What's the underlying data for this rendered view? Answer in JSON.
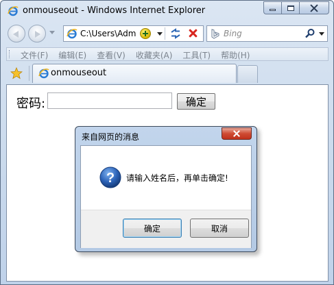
{
  "window": {
    "title": "onmouseout - Windows Internet Explorer"
  },
  "address": {
    "url": "C:\\Users\\Adm"
  },
  "search": {
    "placeholder": "Bing"
  },
  "menu": {
    "items": [
      "文件(F)",
      "编辑(E)",
      "查看(V)",
      "收藏夹(A)",
      "工具(T)",
      "帮助(H)"
    ]
  },
  "tab": {
    "label": "onmouseout"
  },
  "page": {
    "password_label": "密码:",
    "password_value": "",
    "submit_label": "确定"
  },
  "dialog": {
    "title": "来自网页的消息",
    "message": "请输入姓名后，再单击确定!",
    "ok_label": "确定",
    "cancel_label": "取消"
  },
  "colors": {
    "frame": "#c9d9ec",
    "close_red": "#cf4b33",
    "question_blue": "#2c63b8"
  },
  "icons": [
    "ie-icon",
    "minimize-icon",
    "maximize-icon",
    "close-icon",
    "back-arrow-icon",
    "forward-arrow-icon",
    "compat-view-icon",
    "refresh-icon",
    "stop-icon",
    "bing-icon",
    "search-icon",
    "favorites-star-icon",
    "question-icon"
  ]
}
